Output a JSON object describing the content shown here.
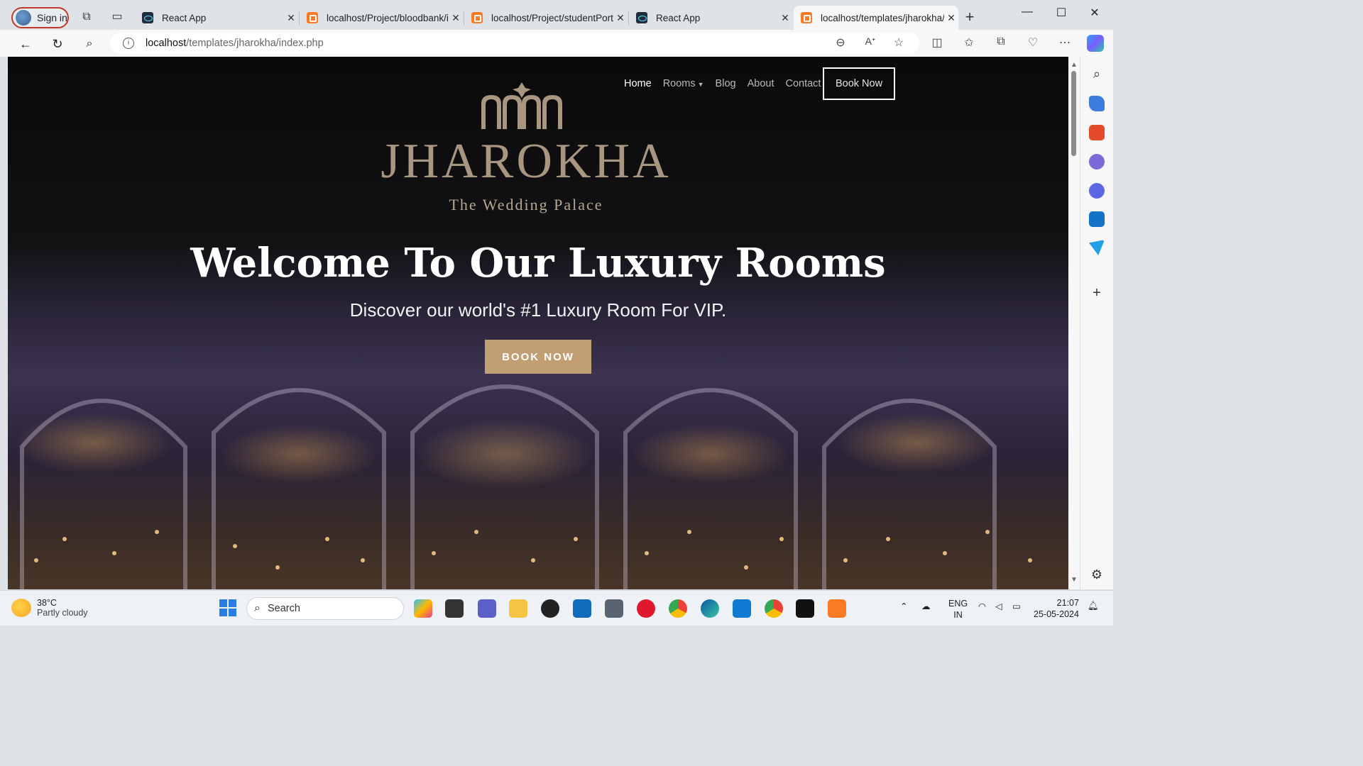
{
  "browser": {
    "signin_label": "Sign in",
    "tabs": [
      {
        "title": "React App",
        "favicon": "react-icon"
      },
      {
        "title": "localhost/Project/bloodbank/in",
        "favicon": "xampp-icon"
      },
      {
        "title": "localhost/Project/studentPorta",
        "favicon": "xampp-icon"
      },
      {
        "title": "React App",
        "favicon": "react-icon"
      },
      {
        "title": "localhost/templates/jharokha/",
        "favicon": "xampp-icon"
      }
    ],
    "url_host": "localhost",
    "url_path": "/templates/jharokha/index.php"
  },
  "site": {
    "nav": {
      "home": "Home",
      "rooms": "Rooms",
      "blog": "Blog",
      "about": "About",
      "contact": "Contact",
      "book_now": "Book Now"
    },
    "logo_title": "JHAROKHA",
    "logo_subtitle": "The Wedding Palace",
    "hero_title": "Welcome To Our Luxury Rooms",
    "hero_subtitle": "Discover our world's #1 Luxury Room For VIP.",
    "hero_button": "BOOK NOW",
    "colors": {
      "accent": "#c29f73",
      "logo": "#a89680"
    }
  },
  "taskbar": {
    "weather_temp": "38°C",
    "weather_cond": "Partly cloudy",
    "search_label": "Search",
    "lang_top": "ENG",
    "lang_bottom": "IN",
    "time": "21:07",
    "date": "25-05-2024"
  }
}
